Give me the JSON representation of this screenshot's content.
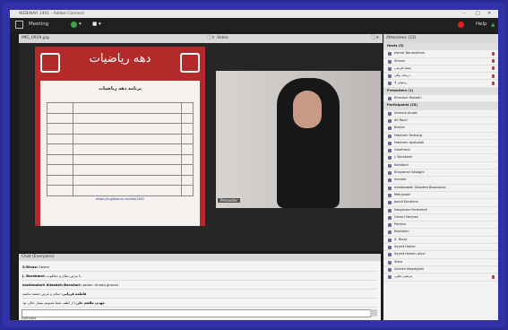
{
  "window": {
    "title": "WEBINAR 1401 - Adobe Connect",
    "controls": [
      "–",
      "□",
      "✕"
    ]
  },
  "menubar": {
    "meeting": "Meeting",
    "audio_arrow": "▾",
    "camera": "■ ▾",
    "help": "Help"
  },
  "share_pod": {
    "title": "IMG_0929.jpg",
    "slide_title": "دهه ریاضیات",
    "program_title": "برنامه دهه ریاضیات",
    "link": "https://o.gilane.ac.ir/note/1401"
  },
  "video_pod": {
    "title": "Video",
    "name_tag": "Presenter"
  },
  "attendees": {
    "title": "Attendees (23)",
    "groups": [
      {
        "label": "Hosts (5)",
        "people": [
          "Ashraf Bananikhah",
          "Shams",
          "صماد قربانی",
          "دریاچه بیگی",
          "رسولی 3"
        ]
      },
      {
        "label": "Presenters (1)",
        "people": [
          "Khosrovi Hossein"
        ]
      },
      {
        "label": "Participants (23)",
        "people": [
          "Ahmadi Amaki",
          "Ali Rouri",
          "Bahira",
          "Fatemeh Farhang",
          "Fatemeh Ayatollah",
          "Golafrand",
          "J. Barakomi",
          "Kambohi",
          "Khayamei Sabaghi",
          "mirzaie",
          "mahboobeh Alizadeh Baradaran",
          "Mahjavani",
          "Javidi Ebrahimi",
          "Nargesian Fereshteh",
          "Omani Nezhad",
          "Parsian",
          "Rasheimi",
          "S. Rivaz",
          "Seyed Hajiee",
          "Seyed Hosein Alavi",
          "Vista",
          "Zohreh Moazigheli",
          "مرتضی ملایی"
        ]
      }
    ]
  },
  "chat_pod": {
    "title": "Chat (Everyone)",
    "messages": [
      {
        "who": "S.Rivaz:",
        "text": "Salam"
      },
      {
        "who": "J. Barakami:",
        "text": "با عرض سلام و خداقوت"
      },
      {
        "who": "mahboobeh Alizadeh Baradari:",
        "text": "salam. khoda ghovat"
      },
      {
        "who": "فاطمه قربانی:",
        "text": "سلام و عرض خسته نباشید"
      },
      {
        "who": "مهدی ملاهم علی:",
        "text": "از لطف شما ممنونم بسیار عالی بود"
      },
      {
        "who": "Nazmina:",
        "text": "salam"
      }
    ],
    "tab": "Everyone"
  }
}
